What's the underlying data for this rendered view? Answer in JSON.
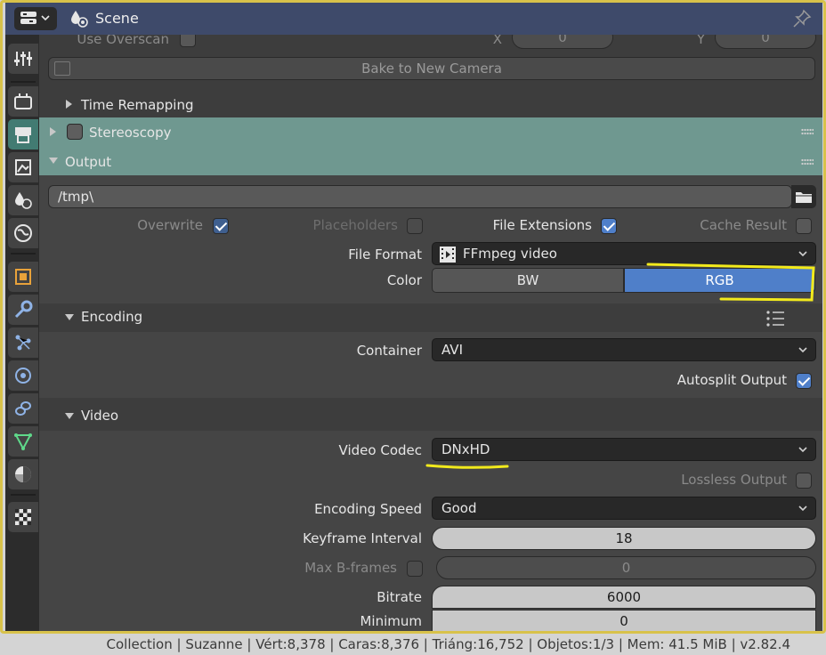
{
  "header": {
    "title": "Scene"
  },
  "overscan": {
    "label": "Use Overscan",
    "x_label": "X",
    "x_value": "0",
    "y_label": "Y",
    "y_value": "0"
  },
  "bake_button": "Bake to New Camera",
  "panels": {
    "time_remapping": "Time Remapping",
    "stereoscopy": "Stereoscopy",
    "output": "Output",
    "encoding": "Encoding",
    "video": "Video"
  },
  "output": {
    "path": "/tmp\\",
    "overwrite": "Overwrite",
    "placeholders": "Placeholders",
    "file_extensions": "File Extensions",
    "cache_result": "Cache Result",
    "file_format_label": "File Format",
    "file_format_value": "FFmpeg video",
    "color_label": "Color",
    "color_options": [
      "BW",
      "RGB"
    ],
    "color_selected": "RGB"
  },
  "encoding": {
    "container_label": "Container",
    "container_value": "AVI",
    "autosplit_label": "Autosplit Output"
  },
  "video": {
    "codec_label": "Video Codec",
    "codec_value": "DNxHD",
    "lossless_label": "Lossless Output",
    "speed_label": "Encoding Speed",
    "speed_value": "Good",
    "keyframe_label": "Keyframe Interval",
    "keyframe_value": "18",
    "bframes_label": "Max B-frames",
    "bframes_value": "0",
    "bitrate_label": "Bitrate",
    "bitrate_value": "6000",
    "minimum_label": "Minimum",
    "minimum_value": "0"
  },
  "statusbar": "Collection | Suzanne | Vért:8,378 | Caras:8,376 | Triáng:16,752 | Objetos:1/3 | Mem: 41.5 MiB | v2.82.4",
  "colors": {
    "header_bg": "#3e4a6a",
    "active_tab": "#427b72",
    "checkbox_on": "#4f7fc9",
    "annotation": "#f2ea1c"
  },
  "sidebar_tabs": [
    "tool-icon",
    "render-icon",
    "output-icon",
    "view-layer-icon",
    "scene-icon",
    "world-icon",
    "object-icon",
    "modifier-icon",
    "particles-icon",
    "physics-icon",
    "constraints-icon",
    "object-data-icon",
    "material-icon",
    "texture-icon"
  ]
}
